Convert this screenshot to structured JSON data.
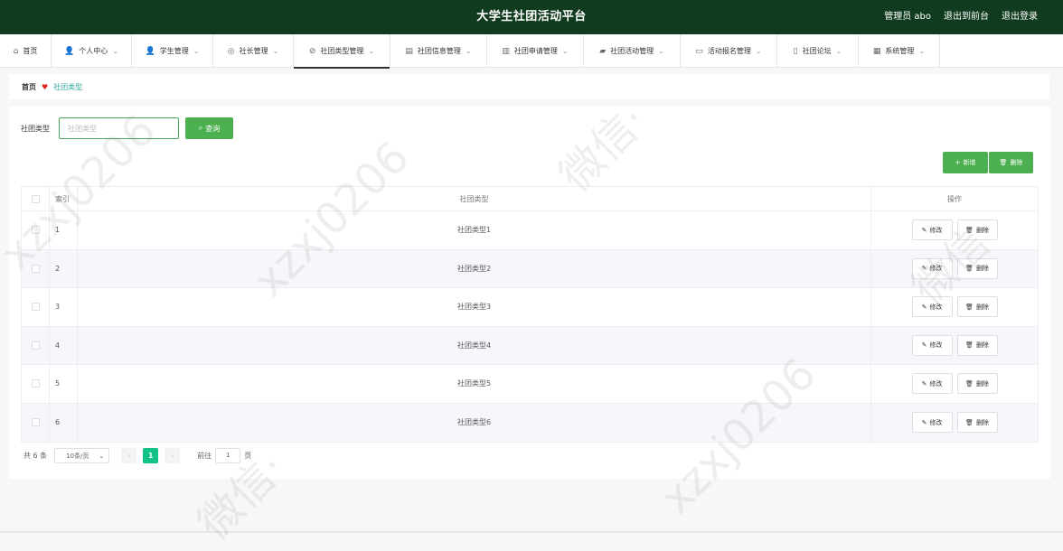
{
  "header": {
    "title": "大学生社团活动平台",
    "user_label": "管理员 abo",
    "back_label": "退出到前台",
    "logout_label": "退出登录"
  },
  "menu": {
    "items": [
      {
        "label": "首页",
        "icon": "home-icon",
        "glyph": "⌂",
        "chev": false,
        "width": 57,
        "active": false
      },
      {
        "label": "个人中心",
        "icon": "user-icon",
        "glyph": "👤",
        "chev": true,
        "width": 89,
        "active": false
      },
      {
        "label": "学生管理",
        "icon": "student-icon",
        "glyph": "👤",
        "chev": true,
        "width": 90,
        "active": false
      },
      {
        "label": "社长管理",
        "icon": "president-icon",
        "glyph": "◎",
        "chev": true,
        "width": 89,
        "active": false
      },
      {
        "label": "社团类型管理",
        "icon": "type-icon",
        "glyph": "⊘",
        "chev": true,
        "width": 107,
        "active": true
      },
      {
        "label": "社团信息管理",
        "icon": "info-icon",
        "glyph": "▤",
        "chev": true,
        "width": 107,
        "active": false
      },
      {
        "label": "社团申请管理",
        "icon": "chart-icon",
        "glyph": "▥",
        "chev": true,
        "width": 107,
        "active": false
      },
      {
        "label": "社团活动管理",
        "icon": "activity-icon",
        "glyph": "▰",
        "chev": true,
        "width": 107,
        "active": false
      },
      {
        "label": "活动报名管理",
        "icon": "signup-icon",
        "glyph": "▭",
        "chev": true,
        "width": 107,
        "active": false
      },
      {
        "label": "社团论坛",
        "icon": "forum-icon",
        "glyph": "▯",
        "chev": true,
        "width": 90,
        "active": false
      },
      {
        "label": "系统管理",
        "icon": "system-icon",
        "glyph": "▦",
        "chev": true,
        "width": 90,
        "active": false
      }
    ]
  },
  "breadcrumb": {
    "home": "首页",
    "current": "社团类型"
  },
  "search": {
    "label": "社团类型",
    "placeholder": "社团类型",
    "query_label": "查询"
  },
  "actions": {
    "add_label": "新增",
    "delete_label": "删除"
  },
  "table": {
    "headers": {
      "index": "索引",
      "type": "社团类型",
      "ops": "操作"
    },
    "edit_label": "修改",
    "delete_label": "删除",
    "rows": [
      {
        "index": "1",
        "type": "社团类型1"
      },
      {
        "index": "2",
        "type": "社团类型2"
      },
      {
        "index": "3",
        "type": "社团类型3"
      },
      {
        "index": "4",
        "type": "社团类型4"
      },
      {
        "index": "5",
        "type": "社团类型5"
      },
      {
        "index": "6",
        "type": "社团类型6"
      }
    ]
  },
  "pagination": {
    "total": "共 6 条",
    "page_size": "10条/页",
    "current_page": "1",
    "goto_label": "前往",
    "goto_value": "1",
    "page_unit": "页"
  },
  "colors": {
    "header_bg": "#113b1f",
    "primary": "#4caf50",
    "page_active": "#13c287"
  }
}
